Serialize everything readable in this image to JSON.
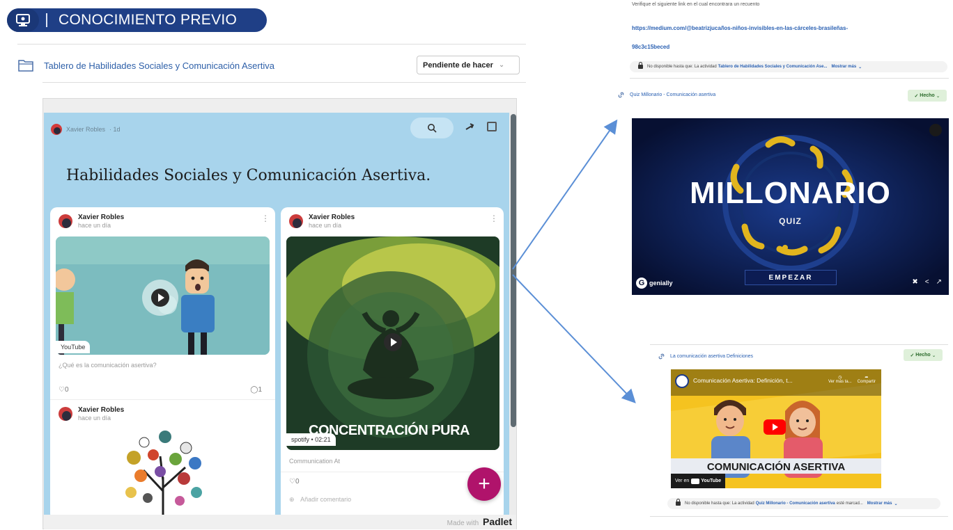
{
  "header": {
    "title": "CONOCIMIENTO PREVIO",
    "icon": "monitor-icon"
  },
  "activity": {
    "title": "Tablero de Habilidades Sociales y Comunicación Asertiva",
    "status": "Pendiente de hacer"
  },
  "padlet": {
    "board_author": "Xavier Robles",
    "board_time": "· 1d",
    "board_title": "Habilidades Sociales y Comunicación Asertiva.",
    "posts": [
      {
        "author": "Xavier Robles",
        "time": "hace un día",
        "media_tag": "YouTube",
        "caption": "¿Qué es la comunicación asertiva?",
        "likes": "0",
        "comments": "1"
      },
      {
        "author": "Xavier Robles",
        "time": "hace un día"
      },
      {
        "author": "Xavier Robles",
        "time": "hace un día",
        "image_text": "CONCENTRACIÓN PURA",
        "media_tag": "spotify • 02:21",
        "caption": "Communication At",
        "likes": "0",
        "comment_placeholder": "Añadir comentario"
      }
    ],
    "fab": "+",
    "footer": {
      "made_with": "Made with",
      "brand": "Padlet"
    }
  },
  "right": {
    "instruction": "Verifique el siguiente link en el cual encontrara un recuento",
    "link_line1": "https://medium.com/@beatrizjuca/los-niños-invisibles-en-las-cárceles-brasileñas-",
    "link_line2": "98c3c15beced",
    "restriction1": {
      "prefix": "No disponible hasta que: La actividad",
      "activity": "Tablero de Habilidades Sociales y Comunicación Ase...",
      "more": "Mostrar más"
    },
    "quiz": {
      "title": "Quiz Millonario - Comunicación asertiva",
      "status": "Hecho",
      "embed_title": "MILLONARIO",
      "embed_subtitle": "QUIZ",
      "start": "EMPEZAR",
      "brand": "genially"
    },
    "video": {
      "title": "La comunicación asertiva Definiciones",
      "status": "Hecho",
      "yt_title": "Comunicación Asertiva: Definición, t...",
      "watch_later": "Ver más ta...",
      "share": "Compartir",
      "caption": "COMUNICACIÓN ASERTIVA",
      "watch_on": "Ver en",
      "yt_brand": "YouTube"
    },
    "restriction2": {
      "prefix": "No disponible hasta que: La actividad",
      "activity": "Quiz Millonario - Comunicación asertiva",
      "suffix": "esté marcad...",
      "more": "Mostrar más"
    }
  },
  "colors": {
    "header_bg": "#1f3f86",
    "padlet_board": "#a8d4ec",
    "fab": "#b0136b",
    "link": "#2a60b2",
    "arrow": "#5b8fd6",
    "done_bg": "#dff0da"
  }
}
